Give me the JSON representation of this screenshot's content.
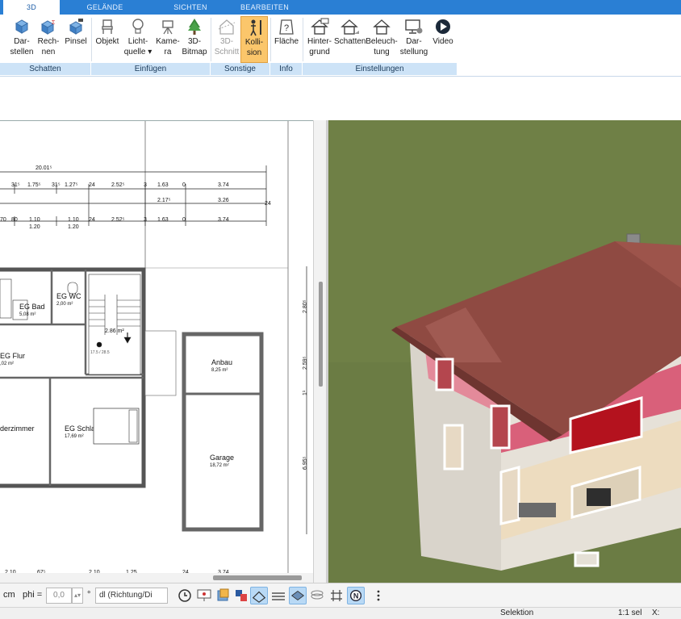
{
  "tabs": [
    {
      "label": "3D",
      "active": true
    },
    {
      "label": "GELÄNDE",
      "active": false
    },
    {
      "label": "SICHTEN",
      "active": false
    },
    {
      "label": "BEARBEITEN",
      "active": false
    }
  ],
  "ribbon": {
    "buttons": [
      {
        "l1": "Dar-",
        "l2": "stellen",
        "icon": "cube-display-icon"
      },
      {
        "l1": "Rech-",
        "l2": "nen",
        "icon": "cube-calc-icon"
      },
      {
        "l1": "Pinsel",
        "l2": "",
        "icon": "paint-cube-icon"
      },
      {
        "l1": "Objekt",
        "l2": "",
        "icon": "chair-icon"
      },
      {
        "l1": "Licht-",
        "l2": "quelle ▾",
        "icon": "light-bulb-icon"
      },
      {
        "l1": "Kame-",
        "l2": "ra",
        "icon": "camera-icon"
      },
      {
        "l1": "3D-",
        "l2": "Bitmap",
        "icon": "tree-icon"
      },
      {
        "l1": "3D-",
        "l2": "Schnitt",
        "icon": "section-icon",
        "disabled": true
      },
      {
        "l1": "Kolli-",
        "l2": "sion",
        "icon": "person-icon",
        "active": true
      },
      {
        "l1": "Fläche",
        "l2": "",
        "icon": "area-info-icon"
      },
      {
        "l1": "Hinter-",
        "l2": "grund",
        "icon": "house-bg-icon"
      },
      {
        "l1": "Schatten",
        "l2": "",
        "icon": "house-shadow-icon"
      },
      {
        "l1": "Beleuch-",
        "l2": "tung",
        "icon": "house-light-icon"
      },
      {
        "l1": "Dar-",
        "l2": "stellung",
        "icon": "monitor-gear-icon"
      },
      {
        "l1": "Video",
        "l2": "",
        "icon": "play-icon"
      }
    ],
    "groups": [
      "Schatten",
      "Einfügen",
      "Sonstige",
      "Info",
      "Einstellungen"
    ]
  },
  "plan": {
    "dims_row1": [
      "20.01⁵"
    ],
    "dims_row2": [
      "31⁵",
      "1.75⁵",
      "31⁵",
      "1.27⁵",
      "24",
      "2.52⁵",
      "3",
      "1.63",
      "0",
      "3.74"
    ],
    "dims_row3": [
      "2.17⁵",
      "3.26",
      "24"
    ],
    "dims_row4": [
      "70",
      "80",
      "1.10",
      "1.20",
      "1.10",
      "1.20",
      "90",
      "24",
      "2.52⁵",
      "3",
      "1.63",
      "0",
      "3.74"
    ],
    "rooms": [
      {
        "name": "EG Bad",
        "area": "5,08 m²"
      },
      {
        "name": "EG WC",
        "area": "2,00 m²"
      },
      {
        "name": "EG Flur",
        "area": ",02 m²"
      },
      {
        "name": "derzimmer",
        "area": ""
      },
      {
        "name": "EG Schlafzimmer",
        "area": "17,69 m²"
      },
      {
        "name": "Anbau",
        "area": "8,25 m²"
      },
      {
        "name": "Garage",
        "area": "18,72 m²"
      }
    ],
    "stair_label": "2.86 m²",
    "stair_sub": "17.5 / 28.5",
    "side_dims": [
      "2.80⁵",
      "2.59⁵",
      "1¹",
      "6.95⁵"
    ],
    "bottom_dims": [
      "2.10",
      "67⁵",
      "2.10",
      "1.25",
      "24",
      "3.74"
    ]
  },
  "bottombar": {
    "unit": "cm",
    "phi_label": "phi =",
    "phi_value": "0,0",
    "deg": "°",
    "direction_placeholder": "dl (Richtung/Di"
  },
  "statusbar": {
    "mode": "Selektion",
    "scale": "1:1 sel",
    "coord_label": "X:"
  }
}
